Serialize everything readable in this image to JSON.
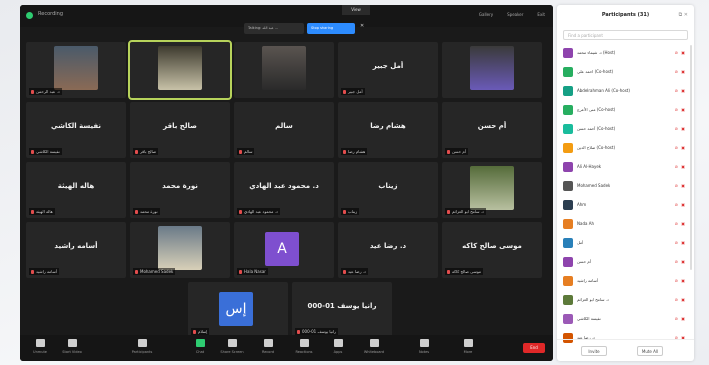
{
  "window": {
    "title": "Recording",
    "talking": "Talking: عبد الله ...",
    "talking_action": "Stop sharing",
    "view": "View",
    "top_right": [
      "Gallery",
      "Speaker",
      "Exit"
    ]
  },
  "tiles": [
    {
      "name": "",
      "label": "د. عبد الرحمن",
      "type": "photo"
    },
    {
      "name": "",
      "label": "",
      "type": "photo",
      "active": true
    },
    {
      "name": "",
      "label": "",
      "type": "photo"
    },
    {
      "name": "أمل جبير",
      "label": "أمل جبير",
      "type": "name"
    },
    {
      "name": "",
      "label": "",
      "type": "photo"
    },
    {
      "name": "نفيسة الكاشي",
      "label": "نفيسة الكاشي",
      "type": "name"
    },
    {
      "name": "صالح باقر",
      "label": "صالح باقر",
      "type": "name"
    },
    {
      "name": "سالم",
      "label": "سالم",
      "type": "name"
    },
    {
      "name": "هشام رضا",
      "label": "هشام رضا",
      "type": "name"
    },
    {
      "name": "أم حسن",
      "label": "أم حسن",
      "type": "name"
    },
    {
      "name": "هاله الهيثة",
      "label": "هاله الهيثة",
      "type": "name"
    },
    {
      "name": "نورة محمد",
      "label": "نورة محمد",
      "type": "name"
    },
    {
      "name": "د. محمود عبد الهادي",
      "label": "د. محمود عبد الهادي",
      "type": "name"
    },
    {
      "name": "زيناب",
      "label": "زيناب",
      "type": "name"
    },
    {
      "name": "",
      "label": "د. سامح ابو العزائم",
      "type": "photo"
    },
    {
      "name": "أسامه راشيد",
      "label": "أسامه راشيد",
      "type": "name"
    },
    {
      "name": "",
      "label": "Mohamed Sadek",
      "type": "photo"
    },
    {
      "name": "",
      "label": "Hala Nasar",
      "type": "avatar",
      "initial": "A",
      "color": "#7e4fcf"
    },
    {
      "name": "د. رضا عيد",
      "label": "د. رضا عيد",
      "type": "name"
    },
    {
      "name": "موسى صالح كاكه",
      "label": "موسى صالح كاكه",
      "type": "name"
    },
    {
      "name": "",
      "label": "إسلام",
      "type": "avatar",
      "initial": "إس",
      "color": "#3a6fd8"
    },
    {
      "name": "رانيا يوسف 01-000",
      "label": "رانيا يوسف 01-000",
      "type": "name"
    }
  ],
  "toolbar": {
    "items": [
      "Unmute",
      "Start Video",
      "Participants",
      "Chat",
      "Share Screen",
      "Record",
      "Reactions",
      "Apps",
      "Whiteboard",
      "Notes",
      "More"
    ],
    "end": "End"
  },
  "panel": {
    "title": "Participants (31)",
    "search_placeholder": "Find a participant",
    "participants": [
      {
        "name": "د. شيماء محمد (Host)",
        "color": "#8e44ad"
      },
      {
        "name": "احمد علي (Co-host)",
        "color": "#27ae60"
      },
      {
        "name": "Abdelrahman Ali (Co-host)",
        "color": "#16a085"
      },
      {
        "name": "منى الأعرج (Co-host)",
        "color": "#27ae60"
      },
      {
        "name": "أحمد حسن (Co-host)",
        "color": "#1abc9c"
      },
      {
        "name": "صلاح الدين (Co-host)",
        "color": "#f39c12"
      },
      {
        "name": "Ali Al-Hayek",
        "color": "#8e44ad"
      },
      {
        "name": "Mohamed Sadek",
        "color": "#555555"
      },
      {
        "name": "Ahm",
        "color": "#2c3e50"
      },
      {
        "name": "Nada Ah",
        "color": "#e67e22"
      },
      {
        "name": "أمل",
        "color": "#2980b9"
      },
      {
        "name": "أم حسن",
        "color": "#8e44ad"
      },
      {
        "name": "أسامه راشيد",
        "color": "#e67e22"
      },
      {
        "name": "د. سامح ابو العزائم",
        "color": "#5d7a3a"
      },
      {
        "name": "نفيسة الكاشي",
        "color": "#9b59b6"
      },
      {
        "name": "د. رضا عيد",
        "color": "#d35400"
      }
    ],
    "invite": "Invite",
    "mute_all": "Mute All"
  }
}
